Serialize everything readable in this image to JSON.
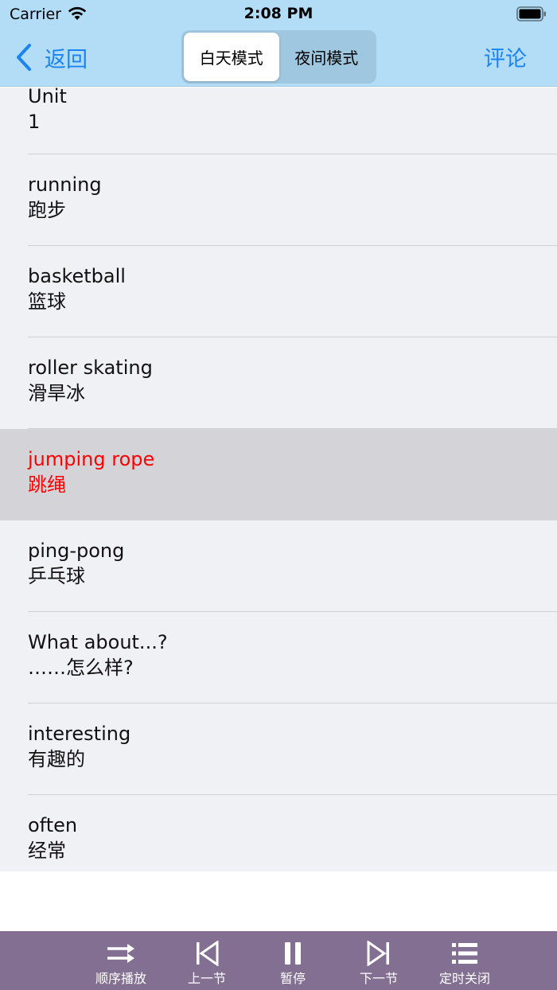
{
  "status_bar": {
    "carrier": "Carrier",
    "time": "2:08 PM"
  },
  "nav": {
    "back_label": "返回",
    "segments": [
      {
        "label": "白天模式",
        "selected": true
      },
      {
        "label": "夜间模式",
        "selected": false
      }
    ],
    "comment_label": "评论"
  },
  "colors": {
    "accent": "#1a84f0",
    "nav_bg": "#b3dcf6",
    "highlight_text": "#ff0000",
    "player_bg": "#836f91"
  },
  "rows": [
    {
      "en": "Unit",
      "zh": "1"
    },
    {
      "en": "running",
      "zh": "跑步"
    },
    {
      "en": "basketball",
      "zh": "篮球"
    },
    {
      "en": "roller skating",
      "zh": "滑旱冰"
    },
    {
      "en": "jumping rope",
      "zh": "跳绳",
      "selected": true
    },
    {
      "en": "ping-pong",
      "zh": "乒乓球"
    },
    {
      "en": "What about...?",
      "zh": "……怎么样?"
    },
    {
      "en": "interesting",
      "zh": "有趣的"
    },
    {
      "en": "often",
      "zh": "经常"
    }
  ],
  "player": {
    "buttons": [
      {
        "icon": "shuffle-order-icon",
        "label": "顺序播放"
      },
      {
        "icon": "previous-track-icon",
        "label": "上一节"
      },
      {
        "icon": "pause-icon",
        "label": "暂停"
      },
      {
        "icon": "next-track-icon",
        "label": "下一节"
      },
      {
        "icon": "timer-list-icon",
        "label": "定时关闭"
      }
    ]
  }
}
